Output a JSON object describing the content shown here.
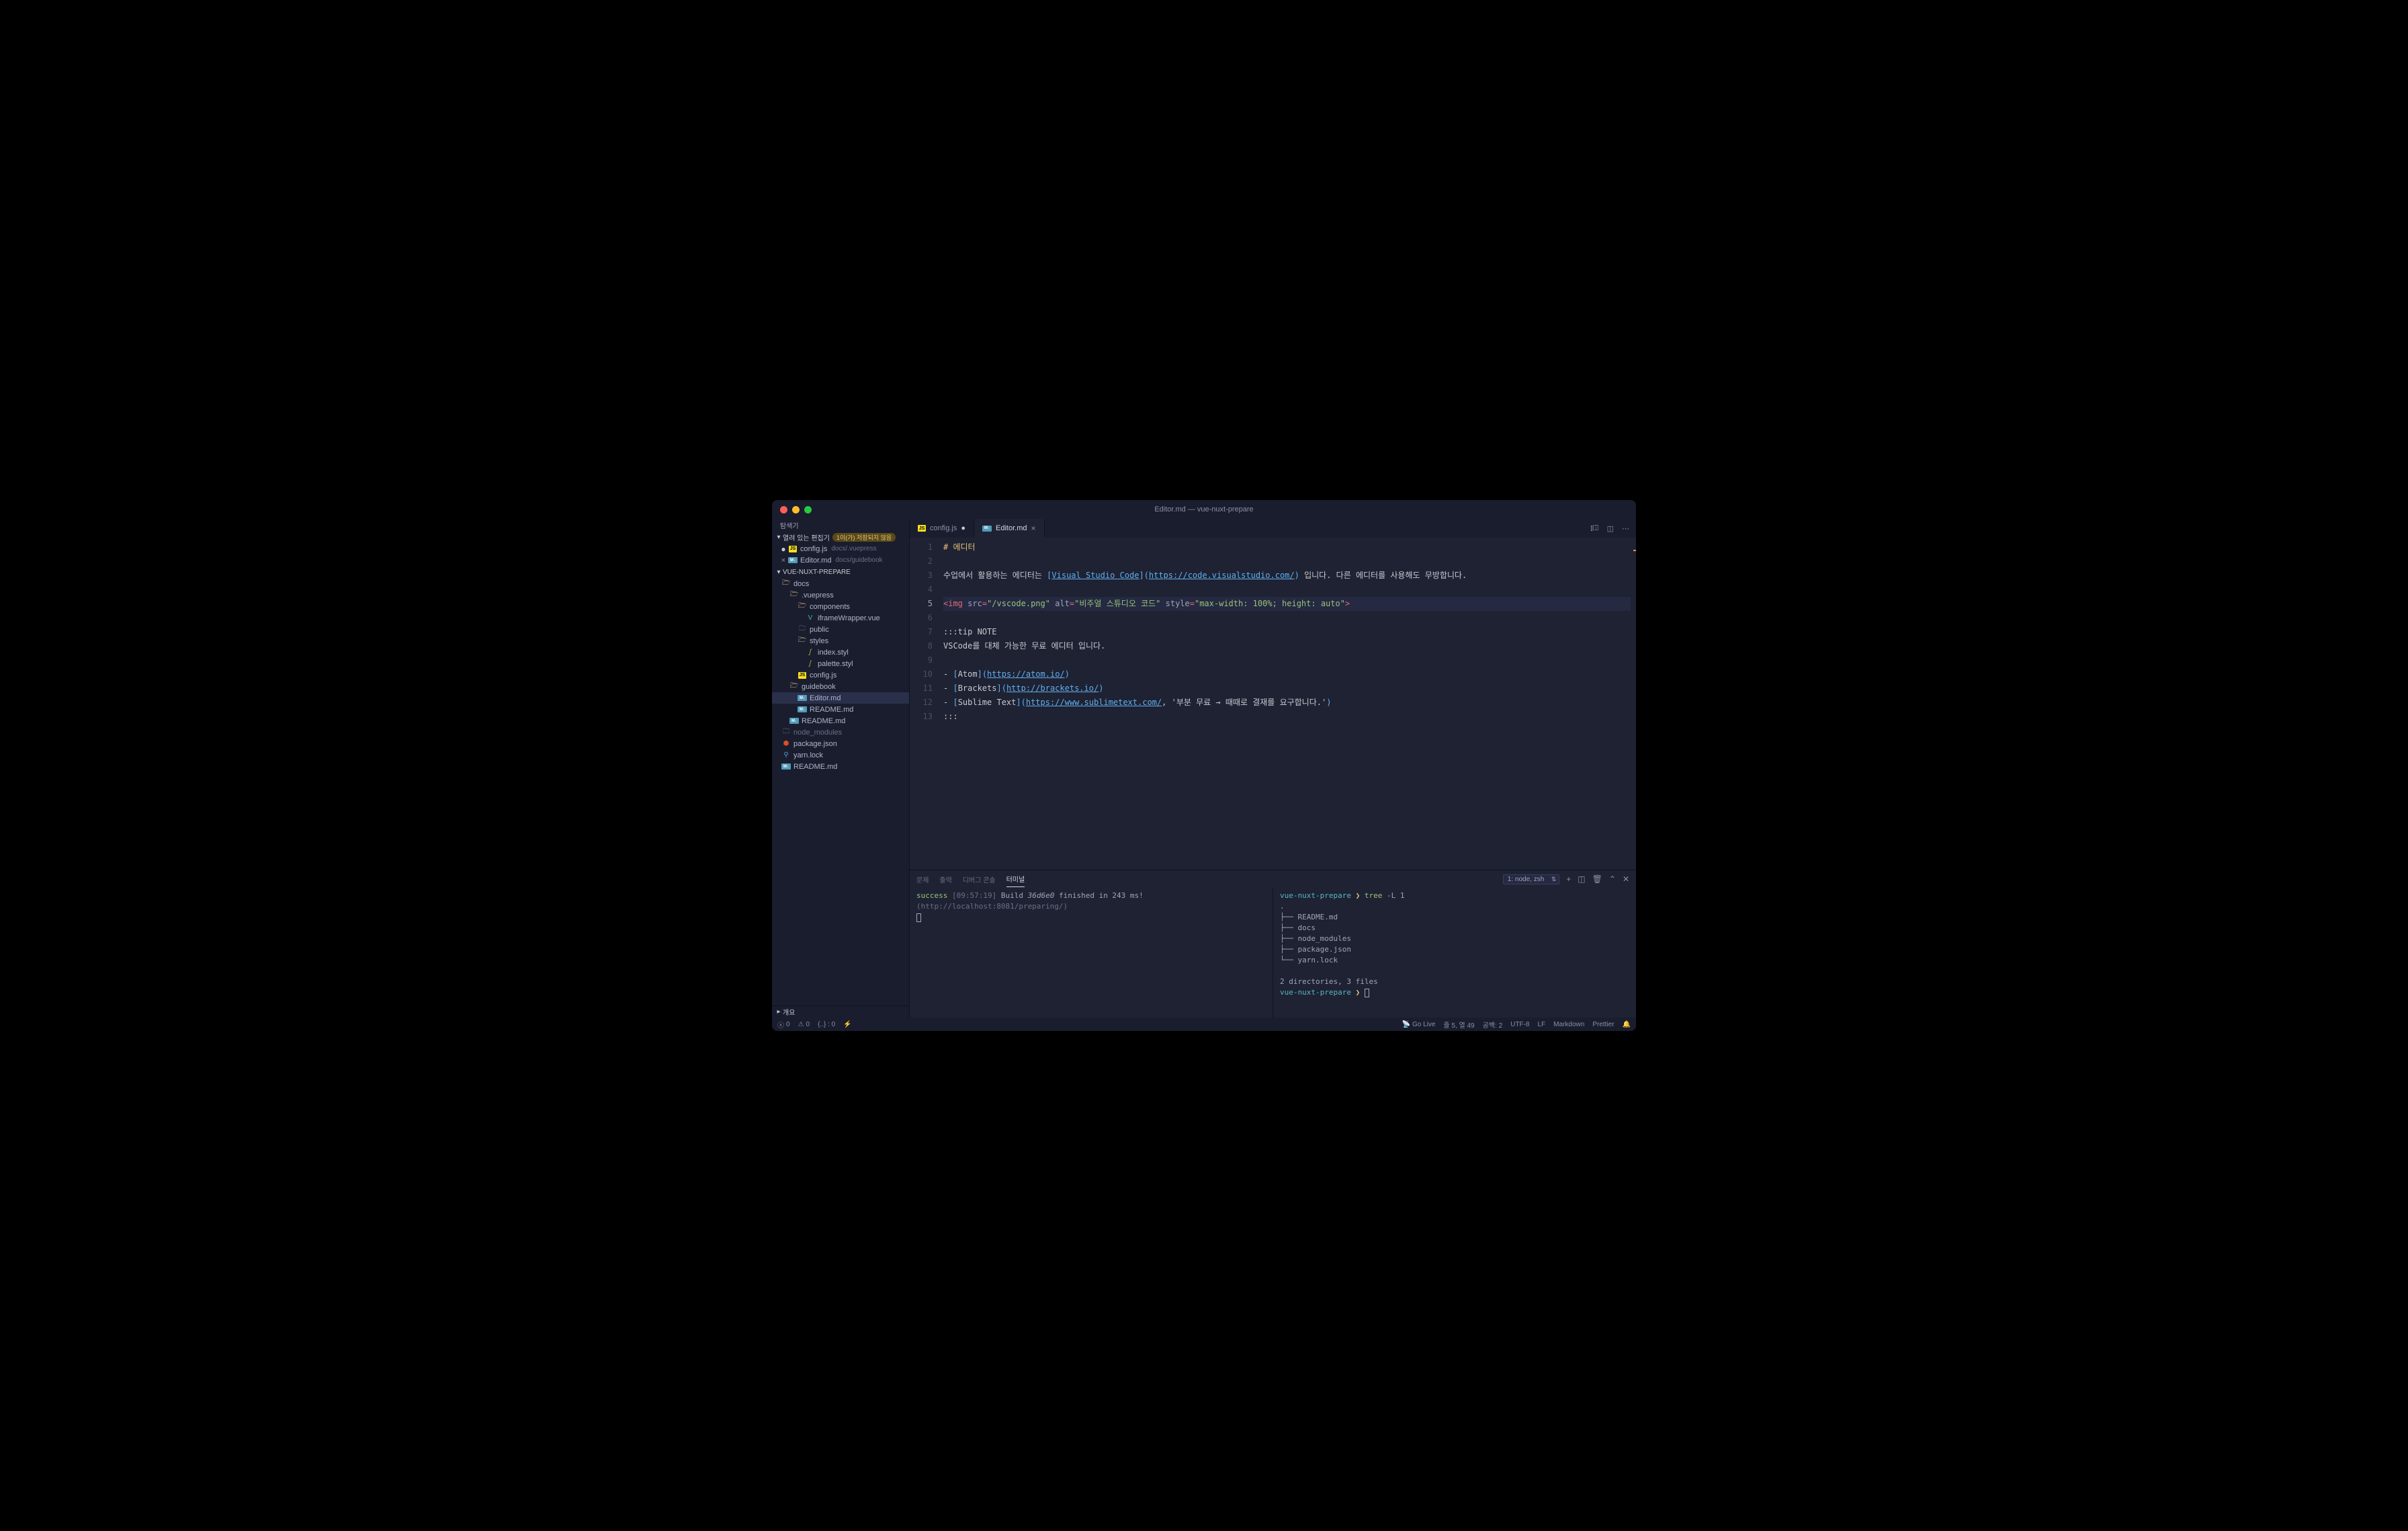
{
  "window_title": "Editor.md — vue-nuxt-prepare",
  "sidebar": {
    "header": "탐색기",
    "open_editors_label": "열려 있는 편집기",
    "open_editors_badge": "1이(가) 저장되지 않음",
    "open_editors": [
      {
        "name": "config.js",
        "path": "docs/.vuepress",
        "icon": "js",
        "modified": true
      },
      {
        "name": "Editor.md",
        "path": "docs/guidebook",
        "icon": "md",
        "active_close": true
      }
    ],
    "project_name": "VUE-NUXT-PREPARE",
    "outline_label": "개요",
    "tree": {
      "docs": "docs",
      "vuepress": ".vuepress",
      "components": "components",
      "iframe": "iframeWrapper.vue",
      "public": "public",
      "styles": "styles",
      "index_styl": "index.styl",
      "palette_styl": "palette.styl",
      "config_js": "config.js",
      "guidebook": "guidebook",
      "editor_md": "Editor.md",
      "readme1": "README.md",
      "readme2": "README.md",
      "node_modules": "node_modules",
      "package_json": "package.json",
      "yarn_lock": "yarn.lock",
      "readme3": "README.md"
    }
  },
  "tabs": [
    {
      "name": "config.js",
      "icon": "js",
      "active": false,
      "dirty": true
    },
    {
      "name": "Editor.md",
      "icon": "md",
      "active": true,
      "close": true
    }
  ],
  "editor": {
    "lines": [
      {
        "n": 1,
        "type": "hdr",
        "parts": [
          [
            "hdr",
            "# 에디터"
          ]
        ]
      },
      {
        "n": 2,
        "type": "blank",
        "parts": []
      },
      {
        "n": 3,
        "type": "text",
        "parts": [
          [
            "text",
            "수업에서 활용하는 에디터는 "
          ],
          [
            "link-bracket",
            "["
          ],
          [
            "link",
            "Visual Studio Code"
          ],
          [
            "link-bracket",
            "]("
          ],
          [
            "link",
            "https://code.visualstudio.com/"
          ],
          [
            "link-bracket",
            ")"
          ],
          [
            "text",
            " 입니다. 다른 에디터를 사용해도 무방합니다."
          ]
        ]
      },
      {
        "n": 4,
        "type": "blank",
        "parts": []
      },
      {
        "n": 5,
        "type": "html",
        "cursor": true,
        "parts": [
          [
            "tag",
            "<img "
          ],
          [
            "attr",
            "src"
          ],
          [
            "tag",
            "="
          ],
          [
            "str",
            "\"/vscode.png\""
          ],
          [
            "tag",
            " "
          ],
          [
            "attr",
            "alt"
          ],
          [
            "tag",
            "="
          ],
          [
            "str",
            "\"비주얼 스튜디오 코드\""
          ],
          [
            "tag",
            " "
          ],
          [
            "attr",
            "style"
          ],
          [
            "tag",
            "="
          ],
          [
            "str",
            "\"max-width: 100%; height: auto\""
          ],
          [
            "tag",
            ">"
          ]
        ]
      },
      {
        "n": 6,
        "type": "blank",
        "parts": []
      },
      {
        "n": 7,
        "type": "text",
        "parts": [
          [
            "text",
            ":::tip NOTE"
          ]
        ]
      },
      {
        "n": 8,
        "type": "text",
        "parts": [
          [
            "text",
            "VSCode를 대체 가능한 무료 에디터 입니다."
          ]
        ]
      },
      {
        "n": 9,
        "type": "blank",
        "parts": []
      },
      {
        "n": 10,
        "type": "text",
        "parts": [
          [
            "text",
            "- "
          ],
          [
            "link-bracket",
            "["
          ],
          [
            "text",
            "Atom"
          ],
          [
            "link-bracket",
            "]("
          ],
          [
            "link",
            "https://atom.io/"
          ],
          [
            "link-bracket",
            ")"
          ]
        ]
      },
      {
        "n": 11,
        "type": "text",
        "parts": [
          [
            "text",
            "- "
          ],
          [
            "link-bracket",
            "["
          ],
          [
            "text",
            "Brackets"
          ],
          [
            "link-bracket",
            "]("
          ],
          [
            "link",
            "http://brackets.io/"
          ],
          [
            "link-bracket",
            ")"
          ]
        ]
      },
      {
        "n": 12,
        "type": "text",
        "parts": [
          [
            "text",
            "- "
          ],
          [
            "link-bracket",
            "["
          ],
          [
            "text",
            "Sublime Text"
          ],
          [
            "link-bracket",
            "]("
          ],
          [
            "link",
            "https://www.sublimetext.com/"
          ],
          [
            "text",
            ", '부분 무료 → 때때로 결재를 요구합니다.'"
          ],
          [
            "link-bracket",
            ")"
          ]
        ]
      },
      {
        "n": 13,
        "type": "text",
        "parts": [
          [
            "text",
            ":::"
          ]
        ]
      }
    ]
  },
  "panel": {
    "tabs": [
      "문제",
      "출력",
      "디버그 콘솔",
      "터미널"
    ],
    "active_tab": 3,
    "terminal_selector": "1: node, zsh",
    "left": {
      "success": "success",
      "time": "[09:57:19]",
      "build_pre": "Build ",
      "build_hash": "36d6e0",
      "build_post": " finished in 243 ms!",
      "url": "(http://localhost:8081/preparing/)"
    },
    "right": {
      "prompt_dir": "vue-nuxt-prepare",
      "prompt_sym": "❯",
      "cmd1": "tree",
      "cmd1_arg": "-L 1",
      "lines": [
        ".",
        "├── README.md",
        "├── docs",
        "├── node_modules",
        "├── package.json",
        "└── yarn.lock",
        "",
        "2 directories, 3 files"
      ]
    }
  },
  "statusbar": {
    "errors": "0",
    "warnings": "0",
    "brackets": "{..} : 0",
    "go_live": "Go Live",
    "cursor_pos": "줄 5, 열 49",
    "spaces": "공백: 2",
    "encoding": "UTF-8",
    "eol": "LF",
    "language": "Markdown",
    "prettier": "Prettier"
  }
}
